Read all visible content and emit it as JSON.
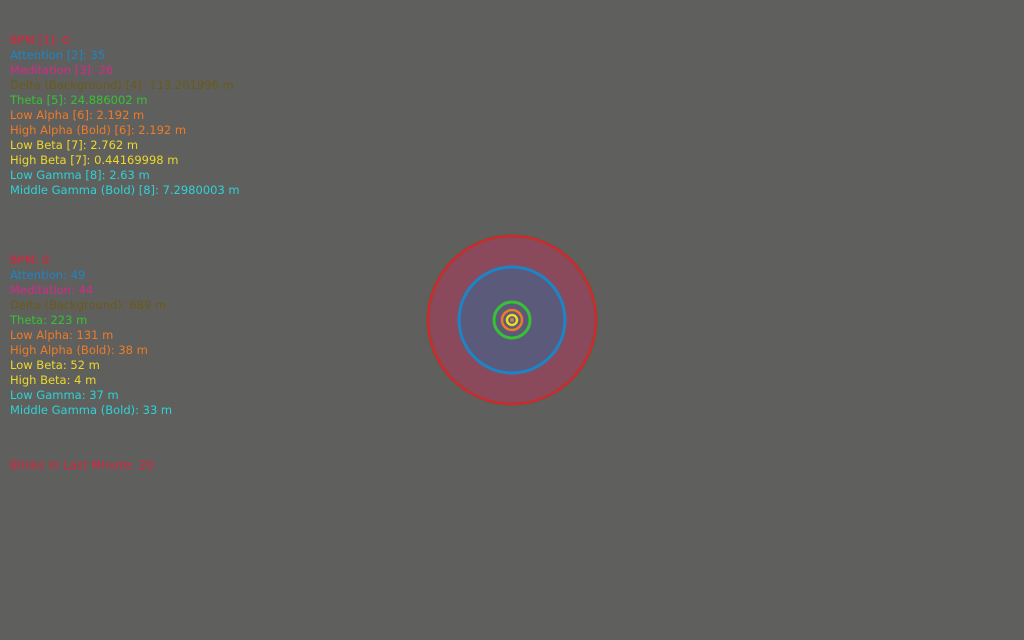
{
  "colors": {
    "background": "#5f605e",
    "bpm": "#e0203a",
    "attention": "#1a86c8",
    "meditation": "#d42a87",
    "delta": "#6a5a18",
    "theta": "#37c232",
    "low_alpha": "#f07a26",
    "high_alpha": "#f07a26",
    "low_beta": "#ecd92a",
    "high_beta": "#ecd92a",
    "low_gamma": "#2ed2d6",
    "middle_gamma": "#2ed2d6",
    "blinks": "#e0203a"
  },
  "raw_readings": [
    {
      "label": "BPM [1]: 0",
      "color_key": "bpm"
    },
    {
      "label": "Attention [2]: 35",
      "color_key": "attention"
    },
    {
      "label": "Meditation [3]: 26",
      "color_key": "meditation"
    },
    {
      "label": "Delta (Background) [4]: 113.201996 m",
      "color_key": "delta"
    },
    {
      "label": "Theta [5]: 24.886002 m",
      "color_key": "theta"
    },
    {
      "label": "Low Alpha [6]: 2.192 m",
      "color_key": "low_alpha"
    },
    {
      "label": "High Alpha (Bold) [6]: 2.192 m",
      "color_key": "high_alpha"
    },
    {
      "label": "Low Beta [7]: 2.762 m",
      "color_key": "low_beta"
    },
    {
      "label": "High Beta [7]: 0.44169998 m",
      "color_key": "high_beta"
    },
    {
      "label": "Low Gamma [8]: 2.63 m",
      "color_key": "low_gamma"
    },
    {
      "label": "Middle Gamma (Bold) [8]: 7.2980003 m",
      "color_key": "middle_gamma"
    }
  ],
  "summary_readings": [
    {
      "label": "BPM: 0",
      "color_key": "bpm"
    },
    {
      "label": "Attention: 49",
      "color_key": "attention"
    },
    {
      "label": "Meditation: 44",
      "color_key": "meditation"
    },
    {
      "label": "Delta (Background):  689 m",
      "color_key": "delta"
    },
    {
      "label": "Theta: 223 m",
      "color_key": "theta"
    },
    {
      "label": "Low Alpha: 131 m",
      "color_key": "low_alpha"
    },
    {
      "label": "High Alpha (Bold): 38 m",
      "color_key": "high_alpha"
    },
    {
      "label": "Low Beta: 52 m",
      "color_key": "low_beta"
    },
    {
      "label": "High Beta: 4 m",
      "color_key": "high_beta"
    },
    {
      "label": "Low Gamma: 37 m",
      "color_key": "low_gamma"
    },
    {
      "label": "Middle Gamma (Bold): 33 m",
      "color_key": "middle_gamma"
    }
  ],
  "blinks": {
    "label": "Blinks In Last Minute: 20",
    "color_key": "blinks"
  },
  "rings": [
    {
      "name": "delta",
      "color_key": "delta",
      "fill": "#8a4a5c",
      "value": 689
    },
    {
      "name": "bpm",
      "color_key": "bpm",
      "value": 0
    },
    {
      "name": "attention",
      "color_key": "attention",
      "fill": "#5c5a7a",
      "value": 49
    },
    {
      "name": "theta",
      "color_key": "theta",
      "value": 223
    },
    {
      "name": "low-alpha",
      "color_key": "low_alpha",
      "value": 131
    },
    {
      "name": "high-beta",
      "color_key": "high_beta",
      "value": 4
    }
  ]
}
